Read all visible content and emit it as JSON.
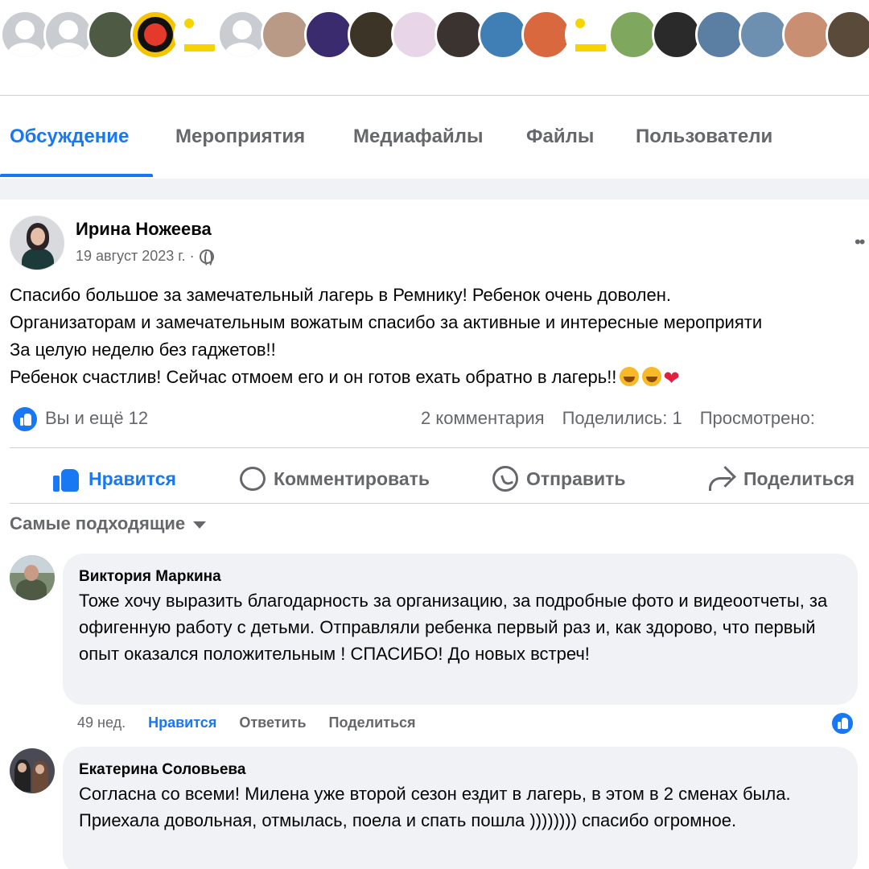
{
  "members": {
    "avatars": [
      {
        "kind": "placeholder"
      },
      {
        "kind": "placeholder"
      },
      {
        "kind": "photo",
        "color": "#4f5a44"
      },
      {
        "kind": "logo"
      },
      {
        "kind": "copy"
      },
      {
        "kind": "placeholder"
      },
      {
        "kind": "photo",
        "color": "#b89a86"
      },
      {
        "kind": "photo",
        "color": "#3a2a6e"
      },
      {
        "kind": "photo",
        "color": "#3d3428"
      },
      {
        "kind": "photo",
        "color": "#e8d6e8"
      },
      {
        "kind": "photo",
        "color": "#3b3330"
      },
      {
        "kind": "photo",
        "color": "#3f7fb6"
      },
      {
        "kind": "photo",
        "color": "#d9683f"
      },
      {
        "kind": "copy"
      },
      {
        "kind": "photo",
        "color": "#7fa85e"
      },
      {
        "kind": "photo",
        "color": "#2a2a2a"
      },
      {
        "kind": "photo",
        "color": "#5b7ea3"
      },
      {
        "kind": "photo",
        "color": "#6d8fb0"
      },
      {
        "kind": "photo",
        "color": "#c98f73"
      },
      {
        "kind": "photo",
        "color": "#5a4a3a"
      }
    ]
  },
  "tabs": [
    {
      "label": "Обсуждение",
      "active": true
    },
    {
      "label": "Мероприятия",
      "active": false
    },
    {
      "label": "Медиафайлы",
      "active": false
    },
    {
      "label": "Файлы",
      "active": false
    },
    {
      "label": "Пользователи",
      "active": false
    }
  ],
  "post": {
    "author": "Ирина Ножеева",
    "date": "19 август 2023 г. ·",
    "more": "••",
    "lines": [
      "Спасибо большое за замечательный лагерь в Ремнику! Ребенок очень доволен.",
      "Организаторам и замечательным вожатым спасибо за активные и интересные мероприяти",
      "За целую неделю без гаджетов!!",
      "Ребенок счастлив! Сейчас отмоем его и он готов ехать обратно в лагерь!!"
    ],
    "reactions_text": "Вы и ещё 12",
    "comments_count": "2 комментария",
    "shares": "Поделились: 1",
    "views": "Просмотрено:",
    "actions": {
      "like": "Нравится",
      "comment": "Комментировать",
      "send": "Отправить",
      "share": "Поделиться"
    },
    "sort_label": "Самые подходящие"
  },
  "comments": [
    {
      "name": "Виктория Маркина",
      "text": "Тоже хочу выразить благодарность за организацию, за подробные фото и видеоотчеты, за офигенную работу с детьми. Отправляли ребенка первый раз и, как здорово, что первый опыт оказался положительным ! СПАСИБО! До новых встреч!",
      "time": "49 нед.",
      "like": "Нравится",
      "reply": "Ответить",
      "share": "Поделиться"
    },
    {
      "name": "Екатерина Соловьева",
      "text": "Согласна со всеми! Милена уже второй сезон ездит в лагерь, в этом в 2 сменах была. Приехала довольная, отмылась, поела и спать пошла )))))))) спасибо огромное."
    }
  ],
  "colors": {
    "accent": "#1877f2",
    "muted": "#65676b",
    "bubble": "#f0f2f5"
  }
}
